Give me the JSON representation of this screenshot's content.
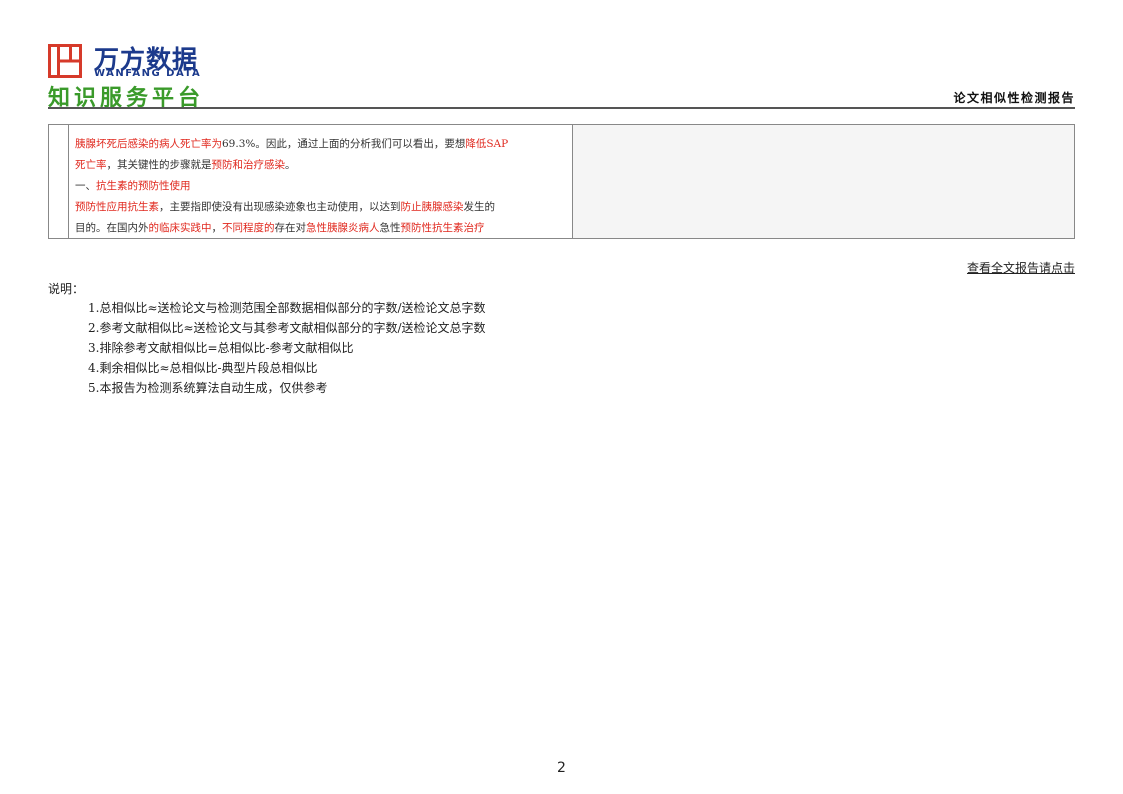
{
  "header": {
    "logo_cn": "万方数据",
    "logo_en": "WANFANG DATA",
    "platform": "知识服务平台",
    "report_title": "论文相似性检测报告",
    "logo_color": "#1c3a8c",
    "logo_mark_color": "#d63a2a",
    "platform_color": "#3a9a2a"
  },
  "fragment": {
    "highlight_color": "#e0281e",
    "lines": [
      [
        {
          "t": "胰腺坏死后感染的病人死亡率为",
          "hl": true
        },
        {
          "t": "69.3%。因此，通过上面的分析我们可以看出，要想",
          "hl": false
        },
        {
          "t": "降低SAP",
          "hl": true
        }
      ],
      [
        {
          "t": "死亡率",
          "hl": true
        },
        {
          "t": "，其关键性的步骤就是",
          "hl": false
        },
        {
          "t": "预防和治疗感染",
          "hl": true
        },
        {
          "t": "。",
          "hl": false
        }
      ],
      [
        {
          "t": "一、",
          "hl": false
        },
        {
          "t": "抗生素的预防性使用",
          "hl": true
        }
      ],
      [
        {
          "t": "预防性应用抗生素",
          "hl": true
        },
        {
          "t": "，主要指即使没有出现感染迹象也主动使用，以达到",
          "hl": false
        },
        {
          "t": "防止胰腺感染",
          "hl": true
        },
        {
          "t": "发生的",
          "hl": false
        }
      ],
      [
        {
          "t": "目的。在国内外",
          "hl": false
        },
        {
          "t": "的临床实践中",
          "hl": true
        },
        {
          "t": "，",
          "hl": false
        },
        {
          "t": "不同程度的",
          "hl": true
        },
        {
          "t": "存在对",
          "hl": false
        },
        {
          "t": "急性胰腺炎病人",
          "hl": true
        },
        {
          "t": "急性",
          "hl": false
        },
        {
          "t": "预防性抗生素治疗",
          "hl": true
        }
      ]
    ]
  },
  "view_full_link": "查看全文报告请点击",
  "notes": {
    "title": "说明：",
    "items": [
      "1.总相似比≈送检论文与检测范围全部数据相似部分的字数/送检论文总字数",
      "2.参考文献相似比≈送检论文与其参考文献相似部分的字数/送检论文总字数",
      "3.排除参考文献相似比=总相似比-参考文献相似比",
      "4.剩余相似比≈总相似比-典型片段总相似比",
      "5.本报告为检测系统算法自动生成，仅供参考"
    ]
  },
  "page_number": "2"
}
